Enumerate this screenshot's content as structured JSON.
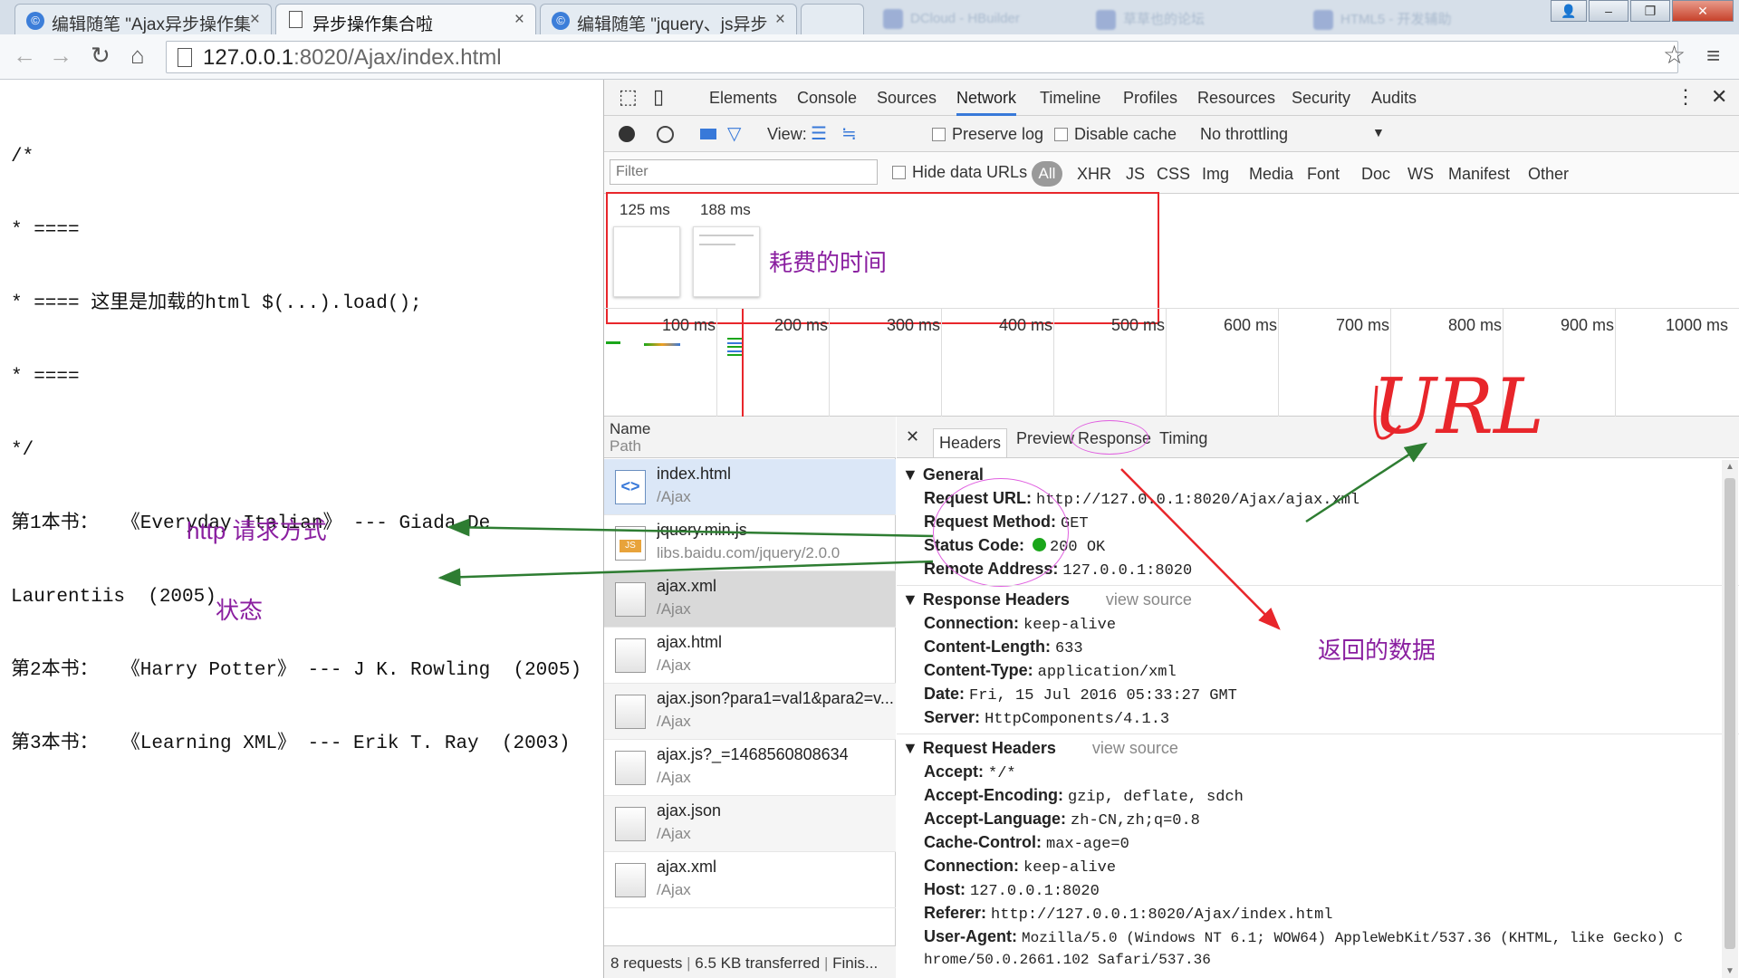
{
  "browser": {
    "tabs": [
      {
        "title": "编辑随笔 \"Ajax异步操作集",
        "icon": "blog-icon"
      },
      {
        "title": "异步操作集合啦",
        "icon": "page-icon"
      },
      {
        "title": "编辑随笔 \"jquery、js异步",
        "icon": "blog-icon"
      }
    ],
    "ghost_tabs": [
      "DCloud - HBuilder",
      "草草也的论坛",
      "HTML5 - 开发辅助"
    ],
    "url_host": "127.0.0.1",
    "url_rest": ":8020/Ajax/index.html"
  },
  "page": {
    "lines": [
      "/*",
      "* ====",
      "* ==== 这里是加载的html $(...).load();",
      "* ====",
      "*/",
      "第1本书：  《Everyday Italian》 --- Giada De",
      "Laurentiis  (2005)",
      "第2本书：  《Harry Potter》 --- J K. Rowling  (2005)",
      "第3本书：  《Learning XML》 --- Erik T. Ray  (2003)"
    ]
  },
  "devtools": {
    "panels": [
      "Elements",
      "Console",
      "Sources",
      "Network",
      "Timeline",
      "Profiles",
      "Resources",
      "Security",
      "Audits"
    ],
    "active_panel": "Network",
    "toolbar": {
      "view_label": "View:",
      "preserve_log": "Preserve log",
      "disable_cache": "Disable cache",
      "throttling": "No throttling"
    },
    "filter": {
      "placeholder": "Filter",
      "hide_data_urls": "Hide data URLs",
      "types": [
        "All",
        "XHR",
        "JS",
        "CSS",
        "Img",
        "Media",
        "Font",
        "Doc",
        "WS",
        "Manifest",
        "Other"
      ]
    },
    "filmstrip": [
      "125 ms",
      "188 ms"
    ],
    "timeline_ticks": [
      "100 ms",
      "200 ms",
      "300 ms",
      "400 ms",
      "500 ms",
      "600 ms",
      "700 ms",
      "800 ms",
      "900 ms",
      "1000 ms"
    ],
    "list_header": {
      "name": "Name",
      "path": "Path"
    },
    "requests": [
      {
        "name": "index.html",
        "path": "/Ajax",
        "type": "html"
      },
      {
        "name": "jquery.min.js",
        "path": "libs.baidu.com/jquery/2.0.0",
        "type": "js"
      },
      {
        "name": "ajax.xml",
        "path": "/Ajax",
        "type": "doc"
      },
      {
        "name": "ajax.html",
        "path": "/Ajax",
        "type": "doc"
      },
      {
        "name": "ajax.json?para1=val1&para2=v...",
        "path": "/Ajax",
        "type": "doc"
      },
      {
        "name": "ajax.js?_=1468560808634",
        "path": "/Ajax",
        "type": "doc"
      },
      {
        "name": "ajax.json",
        "path": "/Ajax",
        "type": "doc"
      },
      {
        "name": "ajax.xml",
        "path": "/Ajax",
        "type": "doc"
      }
    ],
    "summary": {
      "requests": "8 requests",
      "transferred": "6.5 KB transferred",
      "finish": "Finis..."
    },
    "detail_tabs": [
      "Headers",
      "Preview",
      "Response",
      "Timing"
    ],
    "js_badge": "JS",
    "general": {
      "title": "General",
      "rows": [
        {
          "key": "Request URL:",
          "value": "http://127.0.0.1:8020/Ajax/ajax.xml"
        },
        {
          "key": "Request Method:",
          "value": "GET"
        },
        {
          "key": "Status Code:",
          "value": "200 OK"
        },
        {
          "key": "Remote Address:",
          "value": "127.0.0.1:8020"
        }
      ]
    },
    "response_headers": {
      "title": "Response Headers",
      "view_source": "view source",
      "rows": [
        {
          "key": "Connection:",
          "value": "keep-alive"
        },
        {
          "key": "Content-Length:",
          "value": "633"
        },
        {
          "key": "Content-Type:",
          "value": "application/xml"
        },
        {
          "key": "Date:",
          "value": "Fri, 15 Jul 2016 05:33:27 GMT"
        },
        {
          "key": "Server:",
          "value": "HttpComponents/4.1.3"
        }
      ]
    },
    "request_headers": {
      "title": "Request Headers",
      "view_source": "view source",
      "rows": [
        {
          "key": "Accept:",
          "value": "*/*"
        },
        {
          "key": "Accept-Encoding:",
          "value": "gzip, deflate, sdch"
        },
        {
          "key": "Accept-Language:",
          "value": "zh-CN,zh;q=0.8"
        },
        {
          "key": "Cache-Control:",
          "value": "max-age=0"
        },
        {
          "key": "Connection:",
          "value": "keep-alive"
        },
        {
          "key": "Host:",
          "value": "127.0.0.1:8020"
        },
        {
          "key": "Referer:",
          "value": "http://127.0.0.1:8020/Ajax/index.html"
        },
        {
          "key": "User-Agent:",
          "value": "Mozilla/5.0 (Windows NT 6.1; WOW64) AppleWebKit/537.36 (KHTML, like Gecko) C"
        },
        {
          "key": "",
          "value": "hrome/50.0.2661.102 Safari/537.36"
        }
      ]
    }
  },
  "annotations": {
    "time_spent": "耗费的时间",
    "http_method": "http 请求方式",
    "status": "状态",
    "returned_data": "返回的数据",
    "url": "URL"
  },
  "colors": {
    "annotation_purple": "#8a1fa0",
    "annotation_red": "#e8262b",
    "annotation_green": "#2e7d32",
    "devtools_accent": "#3879d9",
    "status_green": "#1aa61a"
  }
}
